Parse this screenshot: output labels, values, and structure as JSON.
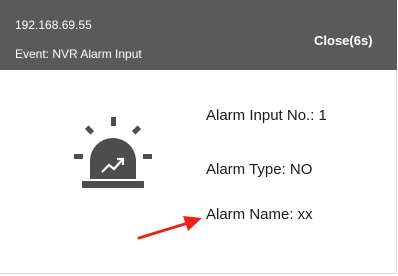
{
  "header": {
    "ip_address": "192.168.69.55",
    "event_text": "Event: NVR Alarm Input",
    "close_label": "Close(6s)"
  },
  "alarm": {
    "input_no_text": "Alarm Input No.: 1",
    "type_text": "Alarm Type: NO",
    "name_text": "Alarm Name:  xx"
  },
  "icons": {
    "alarm": "alarm-siren-icon",
    "annotation": "red-arrow-annotation"
  },
  "colors": {
    "titlebar_bg": "#5a5a5a",
    "titlebar_text": "#ffffff",
    "icon_dark": "#4d4d4d",
    "arrow_red": "#e8231a"
  }
}
